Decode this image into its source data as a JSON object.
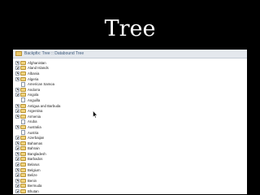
{
  "slide": {
    "title": "Tree"
  },
  "window": {
    "title": "Backpfix: Tree :: Databound Tree"
  },
  "tree": {
    "items": [
      {
        "label": "Afghanistan",
        "type": "folder"
      },
      {
        "label": "Aland Islands",
        "type": "folder"
      },
      {
        "label": "Albania",
        "type": "folder"
      },
      {
        "label": "Algeria",
        "type": "folder"
      },
      {
        "label": "American Samoa",
        "type": "leaf"
      },
      {
        "label": "Andorra",
        "type": "folder"
      },
      {
        "label": "Angola",
        "type": "folder"
      },
      {
        "label": "Anguilla",
        "type": "leaf"
      },
      {
        "label": "Antigua and Barbuda",
        "type": "folder"
      },
      {
        "label": "Argentina",
        "type": "folder"
      },
      {
        "label": "Armenia",
        "type": "folder"
      },
      {
        "label": "Aruba",
        "type": "leaf"
      },
      {
        "label": "Australia",
        "type": "folder"
      },
      {
        "label": "Austria",
        "type": "leaf"
      },
      {
        "label": "Azerbaijan",
        "type": "folder"
      },
      {
        "label": "Bahamas",
        "type": "folder"
      },
      {
        "label": "Bahrain",
        "type": "folder"
      },
      {
        "label": "Bangladesh",
        "type": "folder"
      },
      {
        "label": "Barbados",
        "type": "folder"
      },
      {
        "label": "Belarus",
        "type": "folder"
      },
      {
        "label": "Belgium",
        "type": "folder"
      },
      {
        "label": "Belize",
        "type": "folder"
      },
      {
        "label": "Benin",
        "type": "folder"
      },
      {
        "label": "Bermuda",
        "type": "folder"
      },
      {
        "label": "Bhutan",
        "type": "folder"
      },
      {
        "label": "Bolivia",
        "type": "folder"
      }
    ]
  }
}
